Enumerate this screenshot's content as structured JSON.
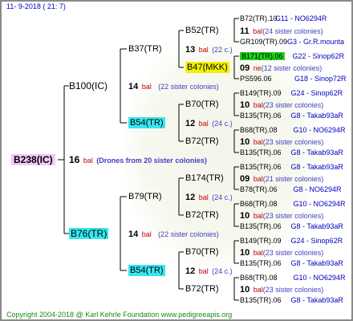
{
  "header": "11-  9-2018 (  21:  7)",
  "footer": "Copyright 2004-2018 @ Karl Kehrle Foundation    www.pedigreeapis.org",
  "root": {
    "label": "B238(IC)",
    "num": "16",
    "bal": "bal",
    "note": "(Drones from 20 sister colonies)"
  },
  "gen1": [
    {
      "label": "B100(IC)",
      "num": "14",
      "bal": "bal",
      "note": "(22 sister colonies)"
    },
    {
      "label": "B76(TR)",
      "num": "14",
      "bal": "bal",
      "note": "(22 sister colonies)"
    }
  ],
  "gen2": [
    {
      "label": "B37(TR)",
      "num": "13",
      "bal": "bal",
      "note": "(22 c.)"
    },
    {
      "label": "B54(TR)",
      "num": "12",
      "bal": "bal",
      "note": "(24 c.)"
    },
    {
      "label": "B79(TR)",
      "num": "12",
      "bal": "bal",
      "note": "(24 c.)"
    },
    {
      "label": "B54(TR)",
      "num": "12",
      "bal": "bal",
      "note": "(24 c.)"
    }
  ],
  "gen3": [
    {
      "label": "B52(TR)",
      "num": "11",
      "bal": "bal",
      "note": "(24 sister colonies)"
    },
    {
      "label": "B47(MKK)",
      "num": "09",
      "bal": "ne",
      "note": "(12 sister colonies)"
    },
    {
      "label": "B70(TR)",
      "num": "10",
      "bal": "bal",
      "note": "(23 sister colonies)"
    },
    {
      "label": "B72(TR)",
      "num": "10",
      "bal": "bal",
      "note": "(23 sister colonies)"
    },
    {
      "label": "B174(TR)",
      "num": "09",
      "bal": "bal",
      "note": "(21 sister colonies)"
    },
    {
      "label": "B72(TR)",
      "num": "10",
      "bal": "bal",
      "note": "(23 sister colonies)"
    },
    {
      "label": "B70(TR)",
      "num": "10",
      "bal": "bal",
      "note": "(23 sister colonies)"
    },
    {
      "label": "B72(TR)",
      "num": "10",
      "bal": "bal",
      "note": "(23 sister colonies)"
    }
  ],
  "gen4": [
    {
      "label": "B72(TR).10",
      "code": "G11 - NO6294R"
    },
    {
      "label": "GR109(TR).09",
      "code": "G3 - Gr.R.mounta"
    },
    {
      "label": "B171(TR).06",
      "code": "G22 - Sinop62R"
    },
    {
      "label": "PS596.06",
      "code": "G18 - Sinop72R"
    },
    {
      "label": "B149(TR).09",
      "code": "G24 - Sinop62R"
    },
    {
      "label": "B135(TR).06",
      "code": "G8 - Takab93aR"
    },
    {
      "label": "B68(TR).08",
      "code": "G10 - NO6294R"
    },
    {
      "label": "B135(TR).06",
      "code": "G8 - Takab93aR"
    },
    {
      "label": "B135(TR).06",
      "code": "G8 - Takab93aR"
    },
    {
      "label": "B78(TR).06",
      "code": "G8 - NO6294R"
    },
    {
      "label": "B68(TR).08",
      "code": "G10 - NO6294R"
    },
    {
      "label": "B135(TR).06",
      "code": "G8 - Takab93aR"
    },
    {
      "label": "B149(TR).09",
      "code": "G24 - Sinop62R"
    },
    {
      "label": "B135(TR).06",
      "code": "G8 - Takab93aR"
    },
    {
      "label": "B68(TR).08",
      "code": "G10 - NO6294R"
    },
    {
      "label": "B135(TR).06",
      "code": "G8 - Takab93aR"
    }
  ]
}
